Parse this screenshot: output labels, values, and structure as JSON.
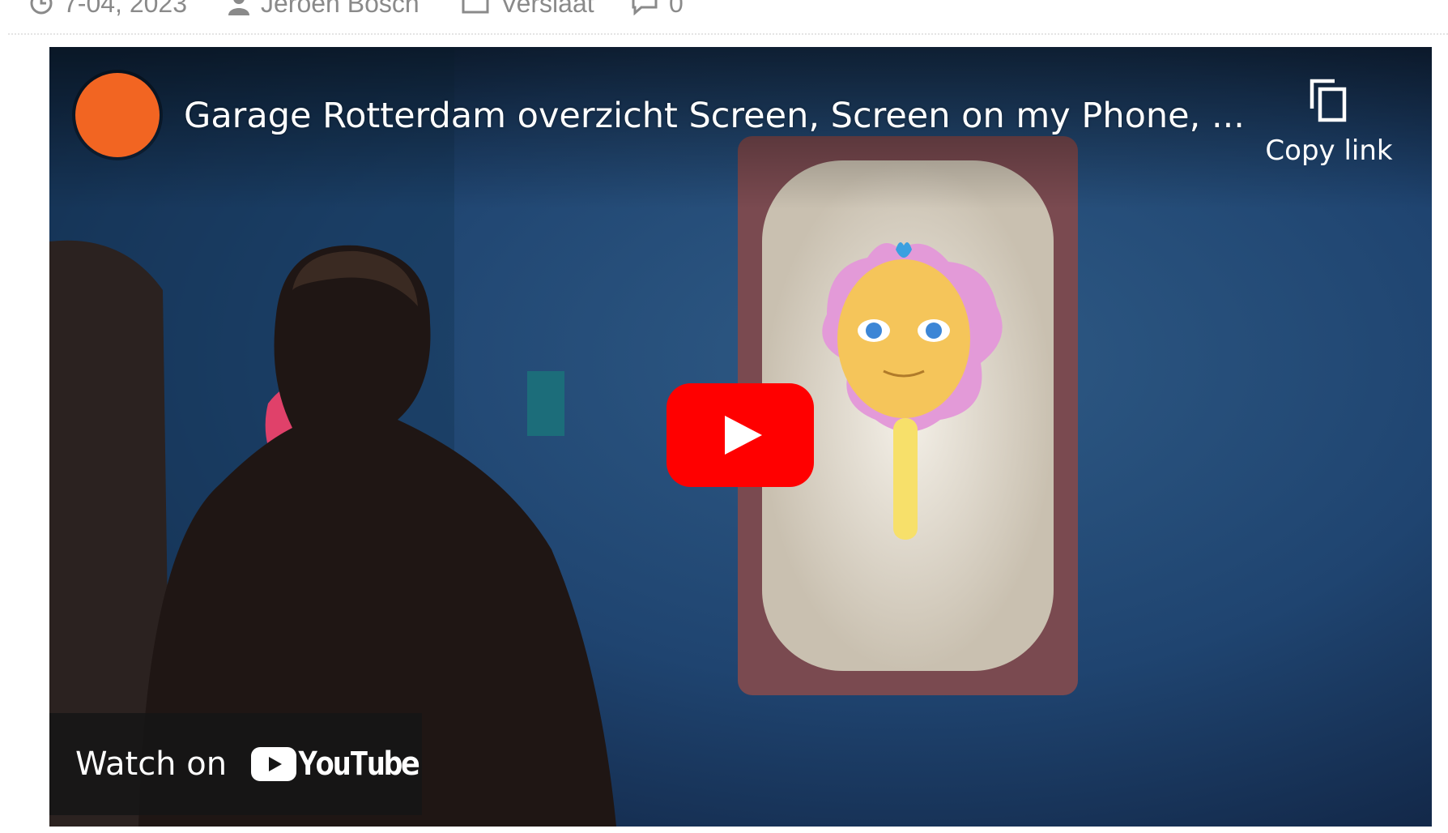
{
  "post_meta": {
    "date": "7-04, 2023",
    "date_icon": "clock-icon",
    "author": "Jeroen Bosch",
    "author_icon": "user-icon",
    "category": "Verslaat",
    "category_icon": "folder-icon",
    "comments": "0",
    "comments_icon": "comment-icon"
  },
  "video": {
    "title": "Garage Rotterdam overzicht Screen, Screen on my Phone, ...",
    "channel_avatar_color": "#f26522",
    "copy_link_label": "Copy link",
    "copy_icon": "copy-icon",
    "play_icon": "play-icon",
    "play_color": "#ff0000",
    "watch_on_label": "Watch on",
    "youtube_wordmark": "YouTube",
    "youtube_icon": "youtube-logo-icon"
  }
}
